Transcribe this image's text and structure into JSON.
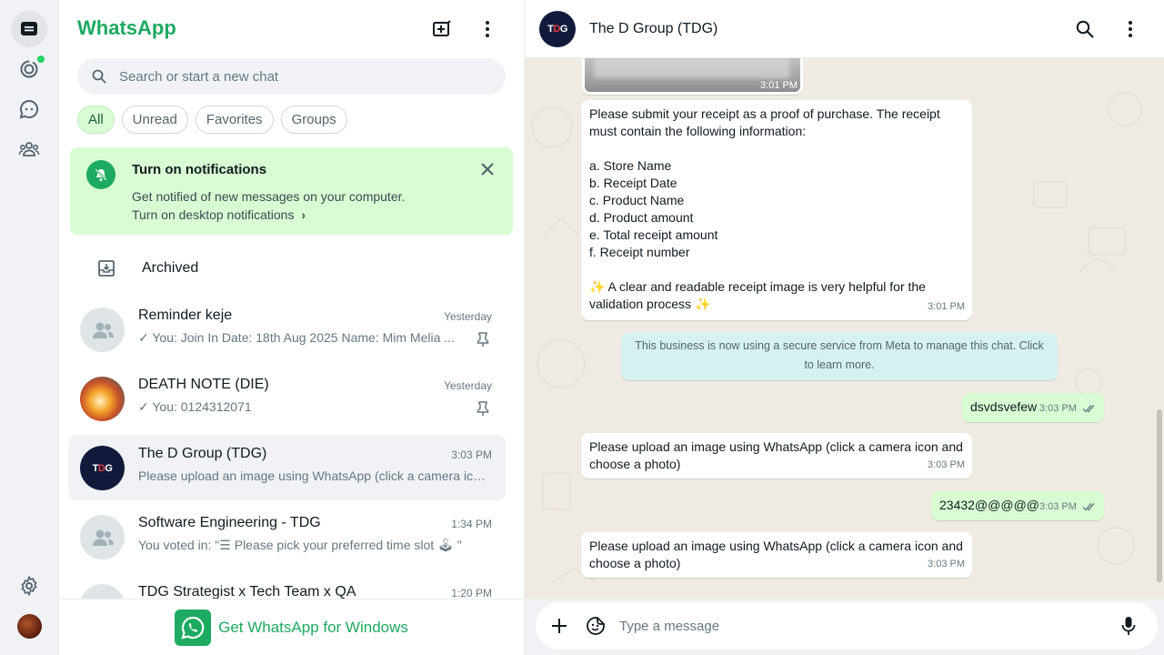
{
  "app": {
    "brand": "WhatsApp"
  },
  "rail": {
    "items": [
      {
        "name": "chats-icon"
      },
      {
        "name": "status-icon"
      },
      {
        "name": "channels-icon"
      },
      {
        "name": "communities-icon"
      }
    ]
  },
  "search": {
    "placeholder": "Search or start a new chat"
  },
  "filters": [
    "All",
    "Unread",
    "Favorites",
    "Groups"
  ],
  "notification": {
    "title": "Turn on notifications",
    "text": "Get notified of new messages on your computer.",
    "link": "Turn on desktop notifications"
  },
  "archived": {
    "label": "Archived"
  },
  "chats": [
    {
      "name": "Reminder keje",
      "time": "Yesterday",
      "preview": "✓ You: Join In Date: 18th  Aug 2025 Name: Mim Melia ...",
      "pinned": true,
      "avatar": "group"
    },
    {
      "name": "DEATH NOTE (DIE)",
      "time": "Yesterday",
      "preview": "✓ You: 0124312071",
      "pinned": true,
      "avatar": "image"
    },
    {
      "name": "The D Group (TDG)",
      "time": "3:03 PM",
      "preview": "Please upload an image using WhatsApp (click a camera ico...",
      "pinned": false,
      "avatar": "tdg",
      "selected": true
    },
    {
      "name": "Software Engineering - TDG",
      "time": "1:34 PM",
      "preview": "You voted in: \"☰ Please pick your preferred time slot 🕹 \"",
      "pinned": false,
      "avatar": "group"
    },
    {
      "name": "TDG Strategist x Tech Team x QA",
      "time": "1:20 PM",
      "preview": "",
      "pinned": false,
      "avatar": "group"
    }
  ],
  "get_app": {
    "label": "Get WhatsApp for Windows"
  },
  "conversation": {
    "title": "The D Group (TDG)",
    "image_time": "3:01 PM",
    "messages": [
      {
        "dir": "in",
        "lines": [
          "Please submit your receipt as a proof of purchase. The receipt",
          "must contain the following information:",
          "",
          "a. Store Name",
          "b. Receipt Date",
          "c. Product Name",
          "d. Product amount",
          "e. Total receipt amount",
          "f. Receipt number",
          "",
          "✨ A clear and readable receipt image is very helpful for the",
          "validation process ✨"
        ],
        "time": "3:01 PM"
      },
      {
        "dir": "out",
        "text": "dsvdsvefew",
        "time": "3:03 PM"
      },
      {
        "dir": "in",
        "lines": [
          "Please upload an image using WhatsApp (click a camera icon and",
          "choose a photo)"
        ],
        "time": "3:03 PM"
      },
      {
        "dir": "out",
        "text": "23432@@@@@",
        "time": "3:03 PM"
      },
      {
        "dir": "in",
        "lines": [
          "Please upload an image using WhatsApp (click a camera icon and",
          "choose a photo)"
        ],
        "time": "3:03 PM"
      }
    ],
    "system_notice": "This business is now using a secure service from Meta to manage this chat. Click to learn more."
  },
  "composer": {
    "placeholder": "Type a message"
  },
  "colors": {
    "brand_green": "#1daa61",
    "incoming": "#ffffff",
    "outgoing": "#d9fdd3",
    "background": "#efeae2"
  }
}
